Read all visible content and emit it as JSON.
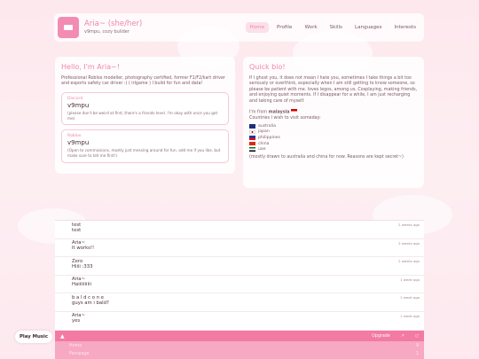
{
  "header": {
    "name": "Aria~ (she/her)",
    "subtitle": "v9mpu, cozy builder",
    "nav": [
      "Home",
      "Profile",
      "Work",
      "Skills",
      "Languages",
      "Interests"
    ]
  },
  "intro": {
    "title": "Hello, I'm Aria~!",
    "description": "Professional Roblox modeller, photography certified, former F1/F2/kart driver and esports safety car driver :) ( irlgame ) I build for fun and data!",
    "discord": {
      "label": "Discord",
      "value": "v9mpu",
      "note": "(please don't be weird at first, there's a friends level. I'm okay with once you get me)"
    },
    "roblox": {
      "label": "Roblox",
      "value": "v9mpu",
      "note": "(Open to commissions, mostly just messing around for fun. add me if you like, but make sure to tell me first!)"
    }
  },
  "bio": {
    "title": "Quick bio!",
    "text": "If I ghost you, it does not mean I hate you, sometimes I take things a bit too seriously or overthink, especially when I am still getting to know someone, so please be patient with me. loves legos, among us, Cosplaying, making friends, and enjoying quiet moments. If I disappear for a while, I am just recharging and taking care of myself.",
    "from_prefix": "I'm from",
    "from_country": "malaysia",
    "visit_heading": "Countries I wish to visit someday:",
    "countries": [
      "australia",
      "japan",
      "philippines",
      "china",
      "uae"
    ],
    "footnote": "(mostly drawn to australia and china for now. Reasons are kept secret~)"
  },
  "chat": {
    "messages": [
      {
        "author": "test",
        "text": "test",
        "time": "2 weeks ago"
      },
      {
        "author": "Aria~",
        "text": "It works!!",
        "time": "2 weeks ago"
      },
      {
        "author": "Zero",
        "text": "Hiiii :333",
        "time": "2 weeks ago"
      },
      {
        "author": "Aria~",
        "text": "Haiiiiiiiiii",
        "time": "1 week ago"
      },
      {
        "author": "b a l d c o n e",
        "text": "guys am i bald?",
        "time": "1 week ago"
      },
      {
        "author": "Aria~",
        "text": "yes",
        "time": "1 week ago"
      }
    ],
    "upgrade_label": "Upgrade",
    "rooms": [
      {
        "name": "Home",
        "count": "9"
      },
      {
        "name": "Passpage",
        "count": "1"
      }
    ]
  },
  "play_music_label": "Play Music",
  "colors": {
    "accent": "#ee86aa",
    "bar": "#f27aa3"
  }
}
